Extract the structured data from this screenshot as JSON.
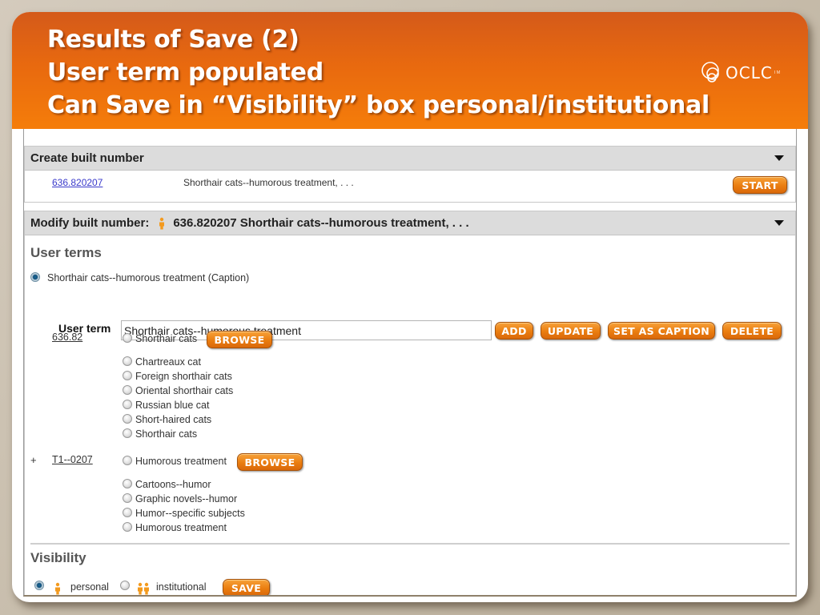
{
  "slide": {
    "title_lines": [
      "Results of Save (2)",
      "User term populated",
      "Can Save in “Visibility” box personal/institutional"
    ],
    "logo": {
      "icon": "oclc-logo-icon",
      "text": "OCLC",
      "tm": "TM"
    },
    "header_color_top": "#d45a1a",
    "header_color_bottom": "#f57d0a"
  },
  "create_panel": {
    "title": "Create built number",
    "number_link": "636.820207",
    "description": "Shorthair cats--humorous treatment, . . .",
    "start_button": "START"
  },
  "modify_panel": {
    "title_prefix": "Modify built number:",
    "title_icon": "personal-icon",
    "title_value": "636.820207 Shorthair cats--humorous treatment, . . .",
    "user_terms": {
      "heading": "User terms",
      "caption_term": "Shorthair cats--humorous treatment  (Caption)",
      "caption_selected": true,
      "field_label": "User term",
      "field_value": "Shorthair cats--humorous treatment",
      "buttons": [
        "ADD",
        "UPDATE",
        "SET AS CAPTION",
        "DELETE"
      ]
    },
    "groups": [
      {
        "expander": "",
        "link": "636.82",
        "main_option": "Shorthair cats",
        "browse_button": "BROWSE",
        "options": [
          "Chartreaux cat",
          "Foreign shorthair cats",
          "Oriental shorthair cats",
          "Russian blue cat",
          "Short-haired cats",
          "Shorthair cats"
        ]
      },
      {
        "expander": "+",
        "link": "T1--0207",
        "main_option": "Humorous treatment",
        "browse_button": "BROWSE",
        "options": [
          "Cartoons--humor",
          "Graphic novels--humor",
          "Humor--specific subjects",
          "Humorous treatment"
        ]
      }
    ],
    "visibility": {
      "heading": "Visibility",
      "options": [
        {
          "label": "personal",
          "icon": "personal-icon",
          "selected": true
        },
        {
          "label": "institutional",
          "icon": "institutional-icon",
          "selected": false
        }
      ],
      "save_button": "SAVE"
    }
  },
  "colors": {
    "accent_orange": "#ea7d10",
    "link_blue": "#3a3acb",
    "panel_header_gray": "#dcdcdc"
  }
}
